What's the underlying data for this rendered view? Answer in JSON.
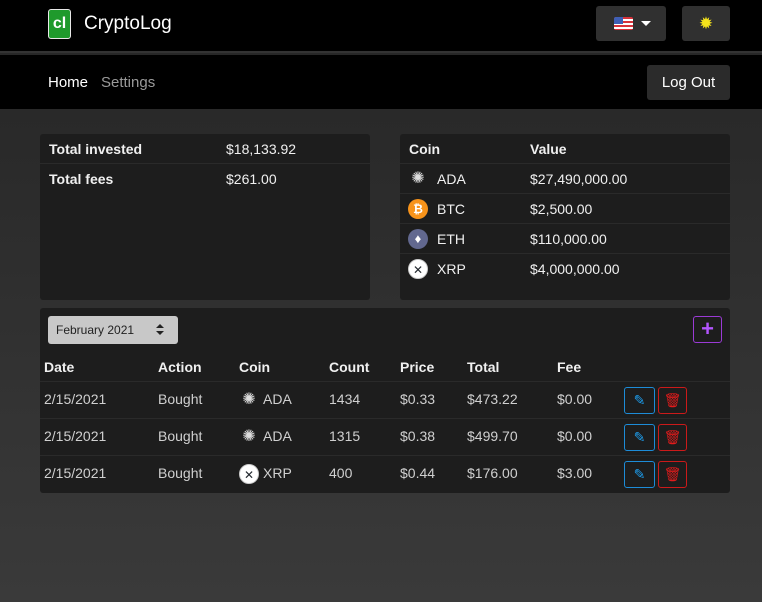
{
  "header": {
    "logo_text": "cl",
    "app_title": "CryptoLog",
    "theme_icon": "sun-icon",
    "language_icon": "us-flag-icon"
  },
  "nav": {
    "home": "Home",
    "settings": "Settings",
    "logout": "Log Out"
  },
  "summary": {
    "rows": [
      {
        "label": "Total invested",
        "value": "$18,133.92"
      },
      {
        "label": "Total fees",
        "value": "$261.00"
      }
    ]
  },
  "coins": {
    "headers": {
      "coin": "Coin",
      "value": "Value"
    },
    "rows": [
      {
        "name": "ADA",
        "value": "$27,490,000.00",
        "icon": "ada-icon"
      },
      {
        "name": "BTC",
        "value": "$2,500.00",
        "icon": "btc-icon"
      },
      {
        "name": "ETH",
        "value": "$110,000.00",
        "icon": "eth-icon"
      },
      {
        "name": "XRP",
        "value": "$4,000,000.00",
        "icon": "xrp-icon"
      }
    ]
  },
  "transactions": {
    "month_select": "February 2021",
    "add_label": "+",
    "headers": {
      "date": "Date",
      "action": "Action",
      "coin": "Coin",
      "count": "Count",
      "price": "Price",
      "total": "Total",
      "fee": "Fee"
    },
    "rows": [
      {
        "date": "2/15/2021",
        "action": "Bought",
        "coin": "ADA",
        "count": "1434",
        "price": "$0.33",
        "total": "$473.22",
        "fee": "$0.00"
      },
      {
        "date": "2/15/2021",
        "action": "Bought",
        "coin": "ADA",
        "count": "1315",
        "price": "$0.38",
        "total": "$499.70",
        "fee": "$0.00"
      },
      {
        "date": "2/15/2021",
        "action": "Bought",
        "coin": "XRP",
        "count": "400",
        "price": "$0.44",
        "total": "$176.00",
        "fee": "$3.00"
      }
    ]
  },
  "colors": {
    "logo": "#1f9a2c",
    "btc": "#f7931a",
    "eth": "#62688f",
    "edit": "#1d9ff0",
    "delete": "#e01b1b",
    "add": "#b355ff"
  }
}
